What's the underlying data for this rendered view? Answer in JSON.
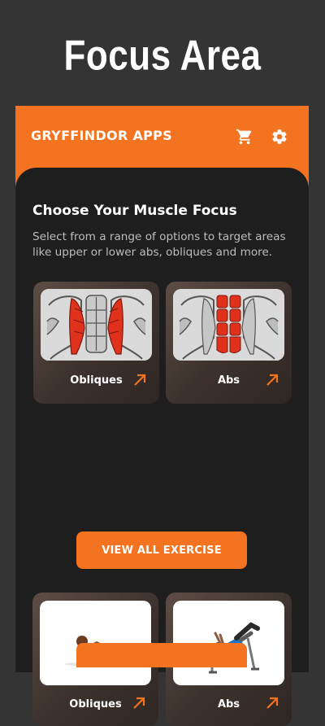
{
  "headline": "Focus Area",
  "app": {
    "title": "GRYFFINDOR APPS",
    "icons": [
      "cart-icon",
      "gear-icon"
    ],
    "accent": "#f37320"
  },
  "section": {
    "title": "Choose Your Muscle Focus",
    "description": "Select from a range of options to target areas like upper or lower abs, obliques and more."
  },
  "muscle_cards": [
    {
      "label": "Obliques",
      "image": "obliques-muscle-illustration"
    },
    {
      "label": "Abs",
      "image": "abs-muscle-illustration"
    }
  ],
  "view_all_button": "VIEW ALL EXERCISE",
  "exercise_cards": [
    {
      "label": "Obliques",
      "image": "crunch-exercise-illustration"
    },
    {
      "label": "Abs",
      "image": "bench-situp-illustration"
    }
  ]
}
